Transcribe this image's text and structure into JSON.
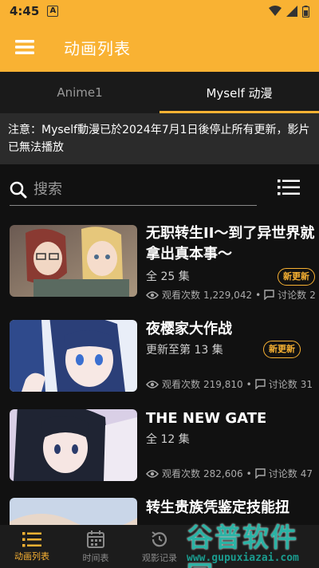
{
  "status_bar": {
    "time": "4:45",
    "notification_letter": "A"
  },
  "app_bar": {
    "title": "动画列表"
  },
  "tabs": [
    {
      "label": "Anime1",
      "active": false
    },
    {
      "label": "Myself 动漫",
      "active": true
    }
  ],
  "notice": "注意：Myself動漫已於2024年7月1日後停止所有更新，影片已無法播放",
  "search": {
    "placeholder": "搜索"
  },
  "items": [
    {
      "title": "无职转生II～到了异世界就拿出真本事～",
      "subtitle": "全 25 集",
      "badge": "新更新",
      "views_label": "观看次数",
      "views": "1,229,042",
      "comments_label": "讨论数",
      "comments": "2"
    },
    {
      "title": "夜樱家大作战",
      "subtitle": "更新至第 13 集",
      "badge": "新更新",
      "views_label": "观看次数",
      "views": "219,810",
      "comments_label": "讨论数",
      "comments": "31"
    },
    {
      "title": "THE NEW GATE",
      "subtitle": "全 12 集",
      "badge": "",
      "views_label": "观看次数",
      "views": "282,606",
      "comments_label": "讨论数",
      "comments": "47"
    },
    {
      "title": "转生贵族凭鉴定技能扭",
      "subtitle": "",
      "badge": "",
      "views_label": "",
      "views": "",
      "comments_label": "",
      "comments": ""
    }
  ],
  "bottom_nav": [
    {
      "label": "动画列表",
      "icon": "list-icon",
      "active": true
    },
    {
      "label": "时间表",
      "icon": "calendar-icon",
      "active": false
    },
    {
      "label": "观影记录",
      "icon": "history-icon",
      "active": false
    }
  ],
  "watermark": {
    "text": "谷普软件园",
    "url": "www.gupuxiazai.com"
  },
  "colors": {
    "accent": "#f9b233",
    "background": "#111111",
    "notice_bg": "#2b2b2b"
  }
}
